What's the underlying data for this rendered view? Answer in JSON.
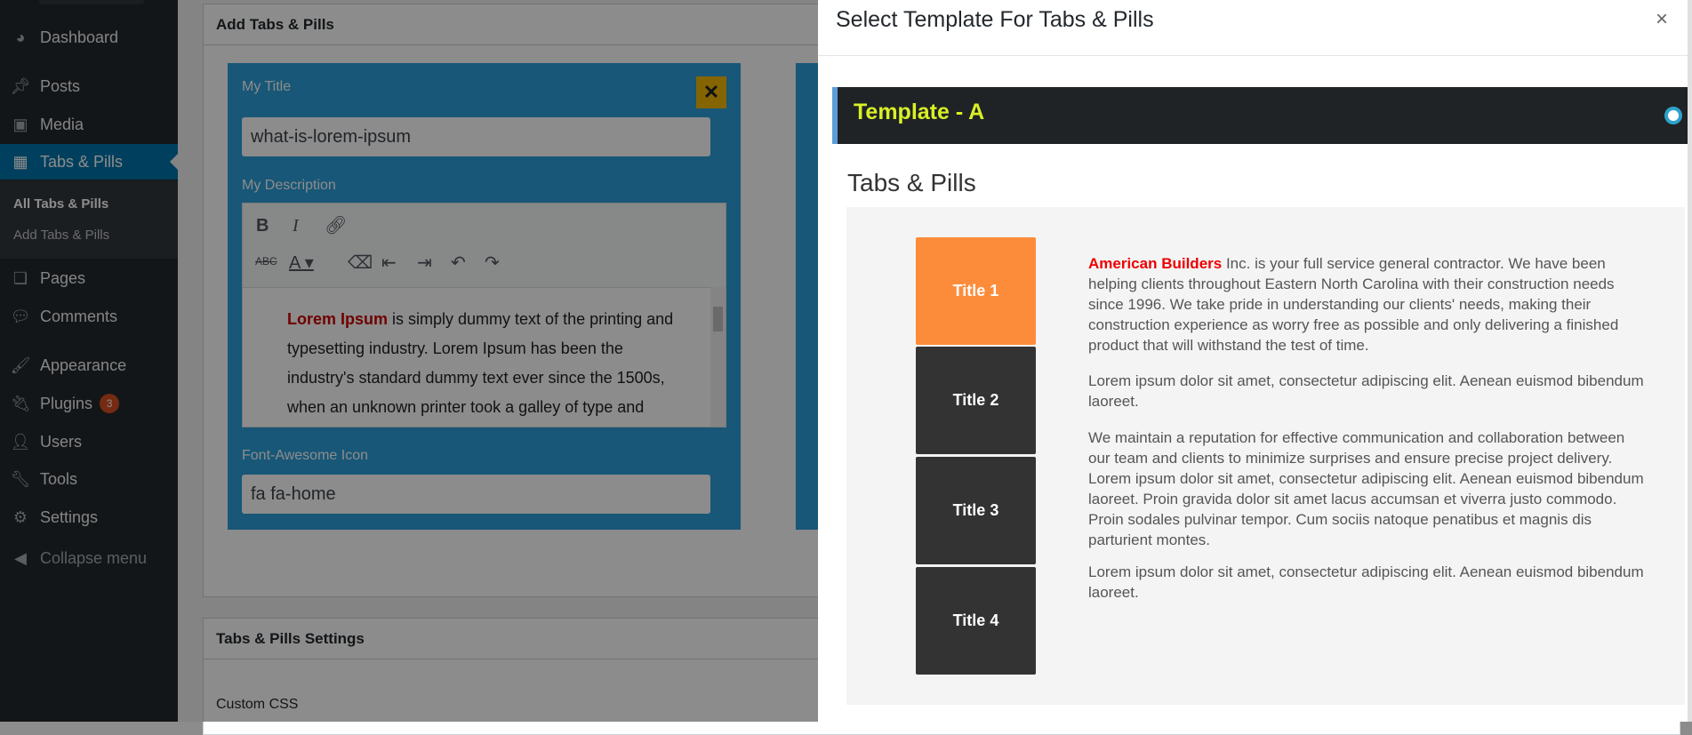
{
  "sidebar": {
    "items": [
      {
        "label": "Dashboard",
        "icon": "dashboard-icon"
      },
      {
        "label": "Posts",
        "icon": "pin-icon"
      },
      {
        "label": "Media",
        "icon": "media-icon"
      },
      {
        "label": "Tabs & Pills",
        "icon": "calendar-icon"
      },
      {
        "label": "Pages",
        "icon": "pages-icon"
      },
      {
        "label": "Comments",
        "icon": "comment-icon"
      },
      {
        "label": "Appearance",
        "icon": "brush-icon"
      },
      {
        "label": "Plugins",
        "icon": "plugin-icon",
        "badge": "3"
      },
      {
        "label": "Users",
        "icon": "user-icon"
      },
      {
        "label": "Tools",
        "icon": "wrench-icon"
      },
      {
        "label": "Settings",
        "icon": "settings-icon"
      },
      {
        "label": "Collapse menu",
        "icon": "collapse-icon"
      }
    ],
    "submenu": [
      "All Tabs & Pills",
      "Add Tabs & Pills"
    ]
  },
  "main": {
    "box_title": "Add Tabs & Pills",
    "card": {
      "title_label": "My Title",
      "title_value": "what-is-lorem-ipsum",
      "desc_label": "My Description",
      "desc_highlight": "Lorem Ipsum",
      "desc_text": " is simply dummy text of the printing and typesetting industry. Lorem Ipsum has been the industry's standard dummy text ever since the 1500s, when an unknown printer took a galley of type and",
      "icon_label": "Font-Awesome Icon",
      "icon_value": "fa fa-home",
      "close_symbol": "✕"
    },
    "settings_title": "Tabs & Pills Settings",
    "custom_css_label": "Custom CSS"
  },
  "modal": {
    "title": "Select Template For Tabs & Pills",
    "close": "×",
    "template_name": "Template - A",
    "section_title": "Tabs & Pills",
    "tabs": [
      "Title 1",
      "Title 2",
      "Title 3",
      "Title 4"
    ],
    "brand": "American Builders",
    "para1": " Inc. is your full service general contractor. We have been helping clients throughout Eastern North Carolina with their construction needs since 1996. We take pride in understanding our clients' needs, making their construction experience as worry free as possible and only delivering a finished product that will withstand the test of time.",
    "para2": "Lorem ipsum dolor sit amet, consectetur adipiscing elit. Aenean euismod bibendum laoreet.",
    "para3": "We maintain a reputation for effective communication and collaboration between our team and clients to minimize surprises and ensure precise project delivery. Lorem ipsum dolor sit amet, consectetur adipiscing elit. Aenean euismod bibendum laoreet. Proin gravida dolor sit amet lacus accumsan et viverra justo commodo. Proin sodales pulvinar tempor. Cum sociis natoque penatibus et magnis dis parturient montes.",
    "para4": "Lorem ipsum dolor sit amet, consectetur adipiscing elit. Aenean euismod bibendum laoreet."
  },
  "colors": {
    "accent": "#0073aa",
    "card": "#2d9fd9",
    "active_tab": "#fd8c3a",
    "template_name": "#d9f026"
  }
}
